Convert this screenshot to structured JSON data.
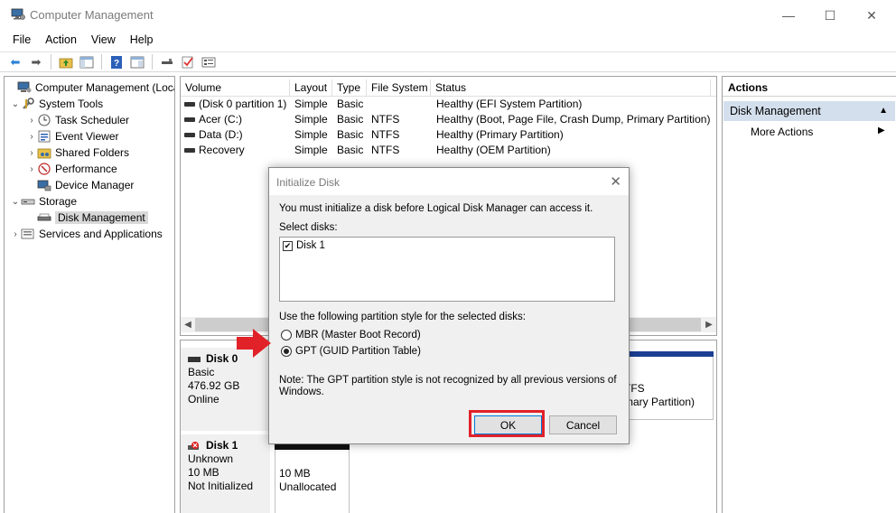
{
  "window": {
    "title": "Computer Management",
    "controls": {
      "minimize": "—",
      "maximize": "☐",
      "close": "✕"
    }
  },
  "menu": [
    "File",
    "Action",
    "View",
    "Help"
  ],
  "toolbar_icons": [
    "back-icon",
    "forward-icon",
    "up-folder-icon",
    "show-hide-tree-icon",
    "help-icon",
    "properties-icon",
    "connect-icon",
    "check-icon",
    "settings-icon"
  ],
  "tree": {
    "root": "Computer Management (Local",
    "system_tools": "System Tools",
    "task_scheduler": "Task Scheduler",
    "event_viewer": "Event Viewer",
    "shared_folders": "Shared Folders",
    "performance": "Performance",
    "device_manager": "Device Manager",
    "storage": "Storage",
    "disk_management": "Disk Management",
    "services": "Services and Applications"
  },
  "volume_table": {
    "headers": [
      "Volume",
      "Layout",
      "Type",
      "File System",
      "Status"
    ],
    "rows": [
      [
        "(Disk 0 partition 1)",
        "Simple",
        "Basic",
        "",
        "Healthy (EFI System Partition)"
      ],
      [
        "Acer (C:)",
        "Simple",
        "Basic",
        "NTFS",
        "Healthy (Boot, Page File, Crash Dump, Primary Partition)"
      ],
      [
        "Data (D:)",
        "Simple",
        "Basic",
        "NTFS",
        "Healthy (Primary Partition)"
      ],
      [
        "Recovery",
        "Simple",
        "Basic",
        "NTFS",
        "Healthy (OEM Partition)"
      ]
    ]
  },
  "disks": {
    "disk0": {
      "name": "Disk 0",
      "type": "Basic",
      "size": "476.92 GB",
      "state": "Online",
      "part_fs": "TFS",
      "part_status": "mary Partition)"
    },
    "disk1": {
      "name": "Disk 1",
      "type": "Unknown",
      "size": "10 MB",
      "state": "Not Initialized",
      "part_size": "10 MB",
      "part_status": "Unallocated"
    }
  },
  "actions": {
    "header": "Actions",
    "section": "Disk Management",
    "more": "More Actions"
  },
  "dialog": {
    "title": "Initialize Disk",
    "intro": "You must initialize a disk before Logical Disk Manager can access it.",
    "select_label": "Select disks:",
    "disk_item": "Disk 1",
    "disk_checked": true,
    "style_label": "Use the following partition style for the selected disks:",
    "mbr": "MBR (Master Boot Record)",
    "gpt": "GPT (GUID Partition Table)",
    "selected_style": "gpt",
    "note_line1": "Note: The GPT partition style is not recognized by all previous versions of",
    "note_line2": "Windows.",
    "ok": "OK",
    "cancel": "Cancel"
  },
  "colors": {
    "highlight_red": "#e12229",
    "disk_bar": "#1c3f94",
    "actions_section_bg": "#d3dfec"
  }
}
